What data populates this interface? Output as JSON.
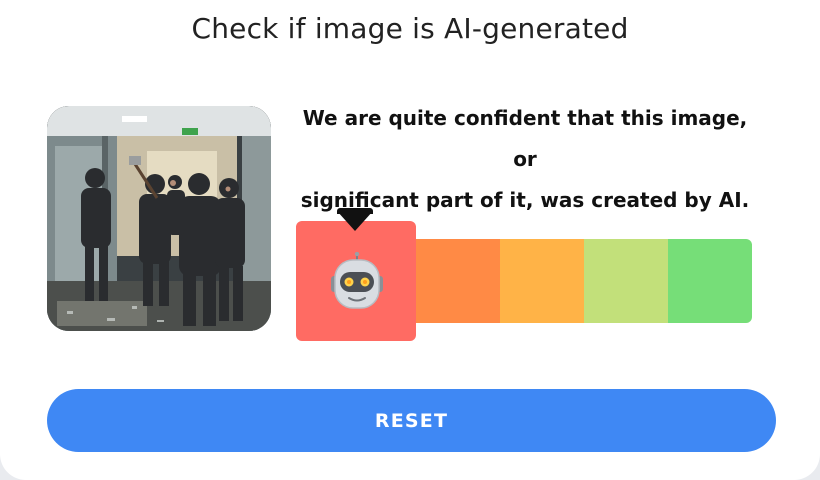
{
  "page": {
    "title": "Check if image is AI-generated"
  },
  "result": {
    "message_line1": "We are quite confident that this image, or",
    "message_line2": "significant part of it, was created by AI.",
    "verdict_level": 1,
    "level_count": 5,
    "level_colors": [
      "#ff6b63",
      "#ff8a45",
      "#ffb347",
      "#c2e07a",
      "#76de78"
    ],
    "active_icon": "robot-face-icon"
  },
  "actions": {
    "reset_label": "RESET"
  }
}
